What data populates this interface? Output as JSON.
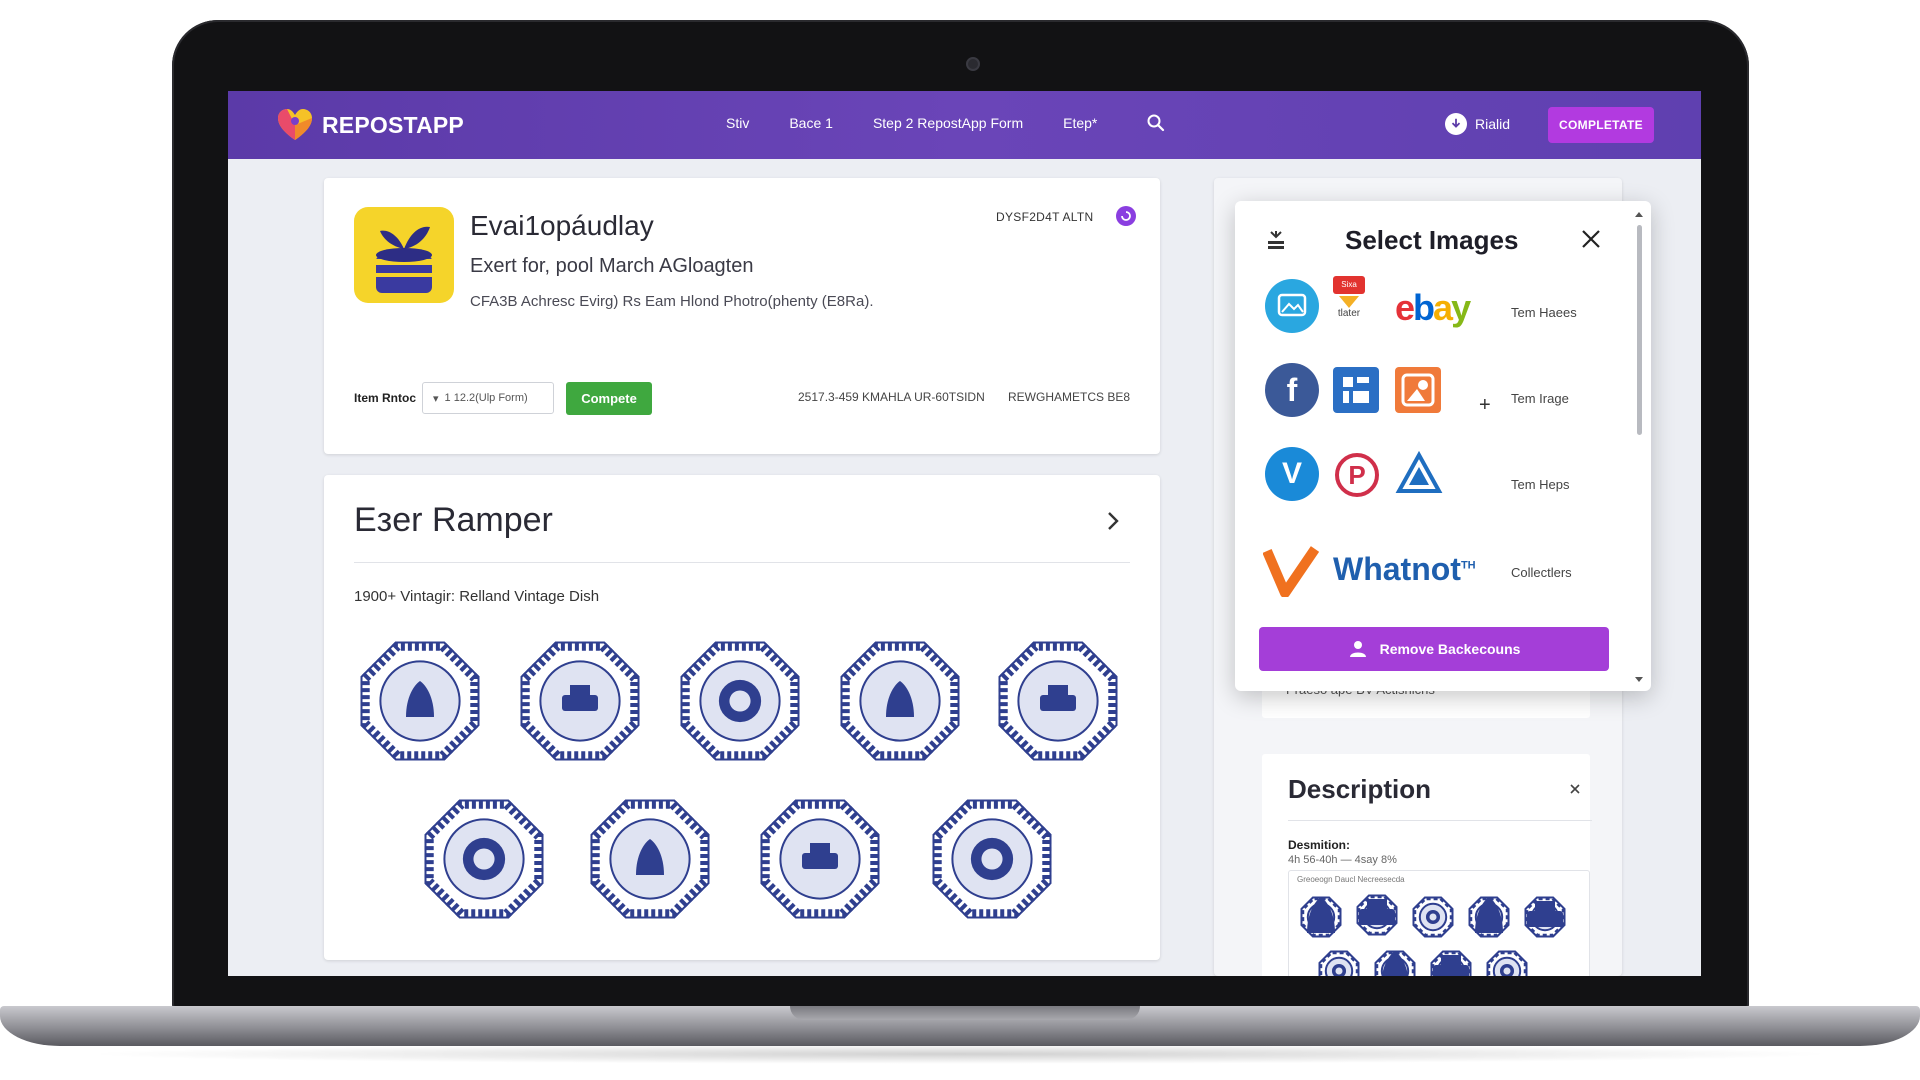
{
  "navbar": {
    "brand": "REPOSTAPP",
    "links": [
      "Stiv",
      "Bace 1",
      "Step 2 RepostApp Form",
      "Etep*"
    ],
    "user_label": "Rialid",
    "complete_label": "COMPLETATE"
  },
  "item": {
    "title": "Evai1opáudlay",
    "subtitle": "Exert for, pool March AGloagten",
    "meta": "CFA3B Achresc Evirg) Rs Eam Hlond Photro(phenty (E8Ra).",
    "status": "DYSF2D4T ALTN",
    "row_label": "Item Rntoc",
    "select_value": "1 12.2(Ulp Form)",
    "compete_label": "Compete",
    "code1": "2517.3-459 KMAHLA UR-60TSIDN",
    "code2": "REWGHAMETCS BE8"
  },
  "gallery": {
    "title": "Eзer Ramper",
    "caption": "1900+ Vintagir: Relland Vintage Dish"
  },
  "modal": {
    "title": "Select Images",
    "row_labels": [
      "Tem Haees",
      "Tem Irage",
      "Tem Heps",
      "Collectlers"
    ],
    "logos": [
      "ebay",
      "Whatnot"
    ],
    "logo_small": "Sixa",
    "logo_sub": "tlater",
    "logo_sup": "TH",
    "remove_label": "Remove Backecouns"
  },
  "panel": {
    "hint": "Praeso ape BV Actisnichs",
    "desc_title": "Description",
    "desc_label": "Desmition:",
    "desc_value": "4h 56-40h — 4say 8%",
    "desc_thumb_caption": "Greoeogn Daucl Necreesecda"
  },
  "colors": {
    "nav": "#5b3aa8",
    "accent": "#b23ae0",
    "green": "#3fa83f",
    "plate_blue": "#2f3f8f"
  }
}
